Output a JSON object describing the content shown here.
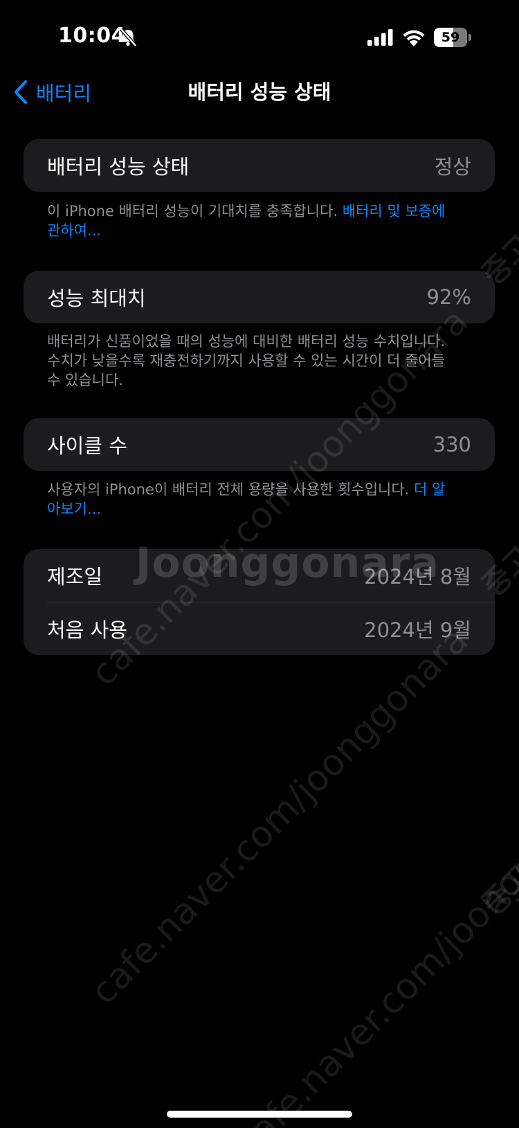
{
  "status_bar": {
    "time": "10:04",
    "battery_level": "59",
    "battery_fraction": 0.59,
    "icons": [
      "bell-slash-icon",
      "cellular-signal-icon",
      "wifi-icon",
      "battery-icon"
    ]
  },
  "nav": {
    "back_label": "배터리",
    "title": "배터리 성능 상태"
  },
  "battery_health": {
    "label": "배터리 성능 상태",
    "value": "정상",
    "footnote_text": "이 iPhone 배터리 성능이 기대치를 충족합니다. ",
    "footnote_link": "배터리 및 보증에 관하여..."
  },
  "max_capacity": {
    "label": "성능 최대치",
    "value": "92%",
    "footnote_text": "배터리가 신품이었을 때의 성능에 대비한 배터리 성능 수치입니다. 수치가 낮을수록 재충전하기까지 사용할 수 있는 시간이 더 줄어들 수 있습니다."
  },
  "cycle_count": {
    "label": "사이클 수",
    "value": "330",
    "footnote_text": "사용자의 iPhone이 배터리 전체 용량을 사용한 횟수입니다. ",
    "footnote_link": "더 알아보기..."
  },
  "dates": {
    "manufacture_label": "제조일",
    "manufacture_value": "2024년 8월",
    "first_use_label": "처음 사용",
    "first_use_value": "2024년 9월"
  },
  "watermark": {
    "url": "cafe.naver.com/joonggonara",
    "brand": "Joonggonara",
    "side": "중고"
  },
  "colors": {
    "background": "#000000",
    "cell": "#1c1c1e",
    "accent": "#0a84ff",
    "secondary_text": "#8e8e93"
  }
}
